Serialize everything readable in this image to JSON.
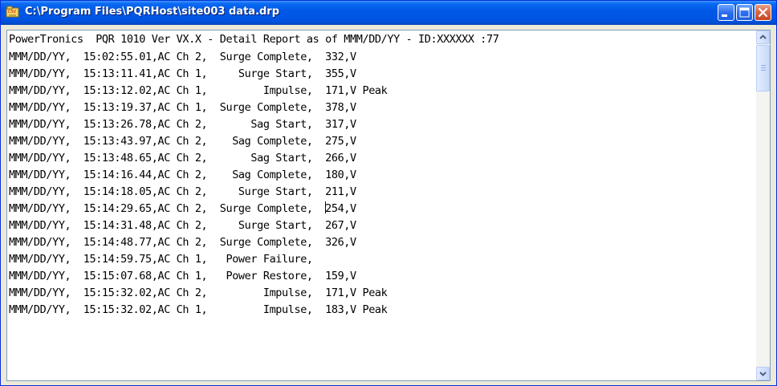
{
  "window": {
    "title": "C:\\Program Files\\PQRHost\\site003 data.drp",
    "icon": "app-icon"
  },
  "titlebar_buttons": [
    "minimize-icon",
    "maximize-icon",
    "close-icon"
  ],
  "report": {
    "header": "PowerTronics  PQR 1010 Ver VX.X - Detail Report as of MMM/DD/YY - ID:XXXXXX :77",
    "lines": [
      "MMM/DD/YY,  15:02:55.01,AC Ch 2,  Surge Complete,  332,V",
      "MMM/DD/YY,  15:13:11.41,AC Ch 1,     Surge Start,  355,V",
      "MMM/DD/YY,  15:13:12.02,AC Ch 1,         Impulse,  171,V Peak",
      "MMM/DD/YY,  15:13:19.37,AC Ch 1,  Surge Complete,  378,V",
      "MMM/DD/YY,  15:13:26.78,AC Ch 2,       Sag Start,  317,V",
      "MMM/DD/YY,  15:13:43.97,AC Ch 2,    Sag Complete,  275,V",
      "MMM/DD/YY,  15:13:48.65,AC Ch 2,       Sag Start,  266,V",
      "MMM/DD/YY,  15:14:16.44,AC Ch 2,    Sag Complete,  180,V",
      "MMM/DD/YY,  15:14:18.05,AC Ch 2,     Surge Start,  211,V",
      "MMM/DD/YY,  15:14:29.65,AC Ch 2,  Surge Complete,  ",
      "MMM/DD/YY,  15:14:31.48,AC Ch 2,     Surge Start,  267,V",
      "MMM/DD/YY,  15:14:48.77,AC Ch 2,  Surge Complete,  326,V",
      "MMM/DD/YY,  15:14:59.75,AC Ch 1,   Power Failure,",
      "MMM/DD/YY,  15:15:07.68,AC Ch 1,   Power Restore,  159,V",
      "MMM/DD/YY,  15:15:32.02,AC Ch 2,         Impulse,  171,V Peak",
      "MMM/DD/YY,  15:15:32.02,AC Ch 1,         Impulse,  183,V Peak"
    ],
    "caret_line_rest": "254,V"
  },
  "scrollbar": {
    "up_icon": "scroll-up-arrow-icon",
    "down_icon": "scroll-down-arrow-icon"
  },
  "colors": {
    "titlebar": "#0055e5",
    "close_button": "#d86a4a",
    "text_border": "#7f9db9",
    "window_face": "#ece9d8"
  }
}
